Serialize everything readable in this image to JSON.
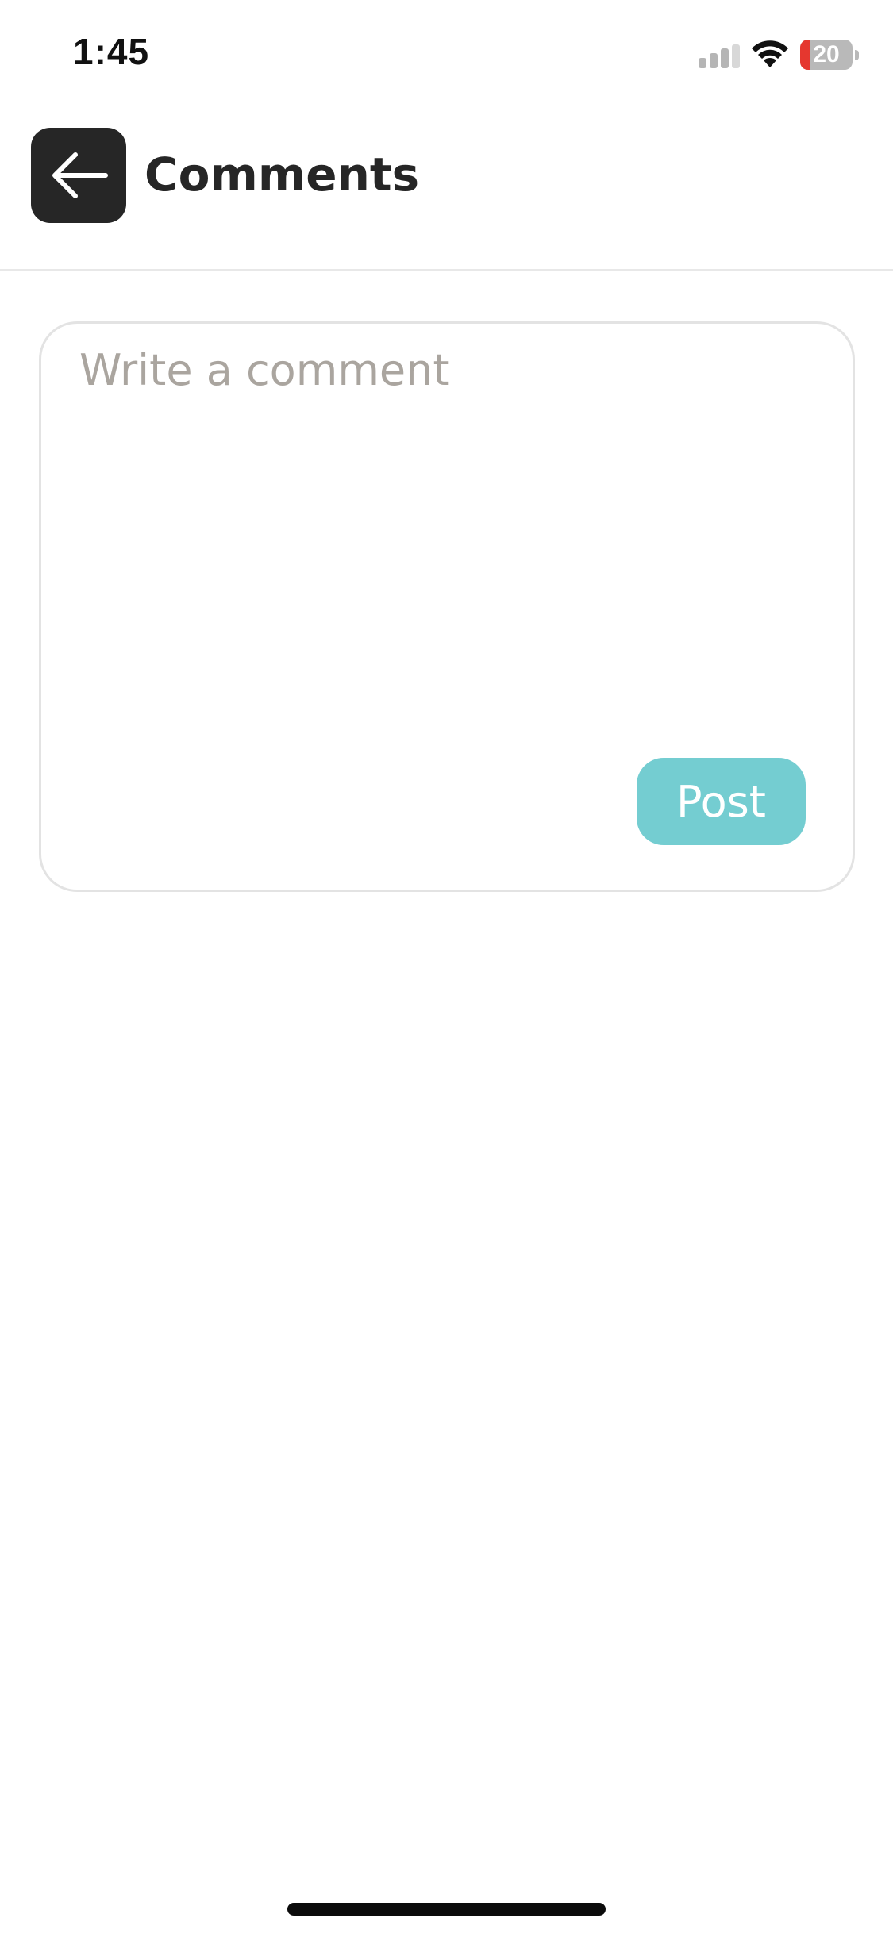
{
  "status_bar": {
    "time": "1:45",
    "battery_level": "20",
    "battery_fraction": 0.2,
    "signal_icon": "cellular-signal-icon",
    "wifi_icon": "wifi-icon",
    "battery_icon": "battery-icon"
  },
  "header": {
    "title": "Comments",
    "back_icon": "arrow-left-icon"
  },
  "comment_form": {
    "placeholder": "Write a comment",
    "value": "",
    "post_label": "Post"
  },
  "colors": {
    "header_button_bg": "#262626",
    "post_button_bg": "#74cdd1",
    "placeholder_text": "#aaa59f",
    "battery_low": "#e5372f"
  }
}
